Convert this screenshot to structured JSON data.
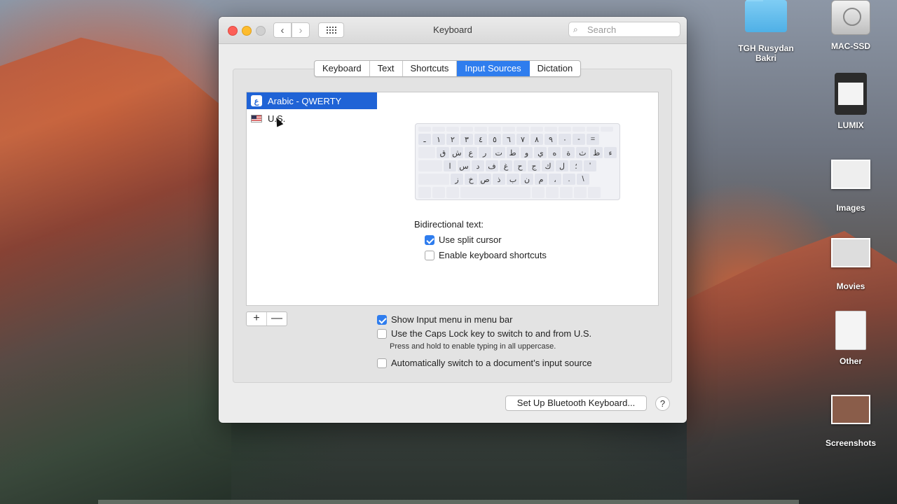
{
  "window": {
    "title": "Keyboard",
    "search_placeholder": "Search"
  },
  "tabs": [
    {
      "label": "Keyboard"
    },
    {
      "label": "Text"
    },
    {
      "label": "Shortcuts"
    },
    {
      "label": "Input Sources",
      "active": true
    },
    {
      "label": "Dictation"
    }
  ],
  "sources": [
    {
      "label": "Arabic - QWERTY",
      "icon": "arabic-letter-icon",
      "icon_glyph": "ع",
      "selected": true
    },
    {
      "label": "U.S.",
      "icon": "us-flag-icon",
      "selected": false
    }
  ],
  "keyboard_rows": [
    [
      "ـ",
      "١",
      "٢",
      "٣",
      "٤",
      "٥",
      "٦",
      "٧",
      "٨",
      "٩",
      "٠",
      "-",
      "="
    ],
    [
      "ق",
      "ش",
      "ع",
      "ر",
      "ت",
      "ط",
      "و",
      "ي",
      "ه",
      "ة",
      "ث",
      "ظ",
      "ء"
    ],
    [
      "ا",
      "س",
      "د",
      "ف",
      "غ",
      "ح",
      "ج",
      "ك",
      "ل",
      "؛",
      "'"
    ],
    [
      "ز",
      "خ",
      "ص",
      "ذ",
      "ب",
      "ن",
      "م",
      "،",
      ".",
      "\\"
    ]
  ],
  "bidi": {
    "label": "Bidirectional text:",
    "split_cursor": {
      "label": "Use split cursor",
      "checked": true
    },
    "kbd_shortcuts": {
      "label": "Enable keyboard shortcuts",
      "checked": false
    }
  },
  "options": {
    "show_menu": {
      "label": "Show Input menu in menu bar",
      "checked": true
    },
    "caps_lock": {
      "label": "Use the Caps Lock key to switch to and from U.S.",
      "checked": false
    },
    "caps_note": "Press and hold to enable typing in all uppercase.",
    "auto_switch": {
      "label": "Automatically switch to a document’s input source",
      "checked": false
    }
  },
  "buttons": {
    "add": "+",
    "remove": "—",
    "bluetooth": "Set Up Bluetooth Keyboard...",
    "help": "?"
  },
  "desktop": [
    {
      "label": "TGH Rusydan Bakri",
      "icon": "folder-icon"
    },
    {
      "label": "MAC-SSD",
      "icon": "hard-drive-icon"
    },
    {
      "label": "LUMIX",
      "icon": "sd-card-icon"
    },
    {
      "label": "Images",
      "icon": "image-folder-icon"
    },
    {
      "label": "Movies",
      "icon": "movies-folder-icon"
    },
    {
      "label": "Other",
      "icon": "document-icon"
    },
    {
      "label": "Screenshots",
      "icon": "screenshots-folder-icon"
    }
  ],
  "colors": {
    "accent": "#2f7dee",
    "selection": "#1f63d6",
    "close": "#fc5f57",
    "minimize": "#fdbc2e"
  }
}
